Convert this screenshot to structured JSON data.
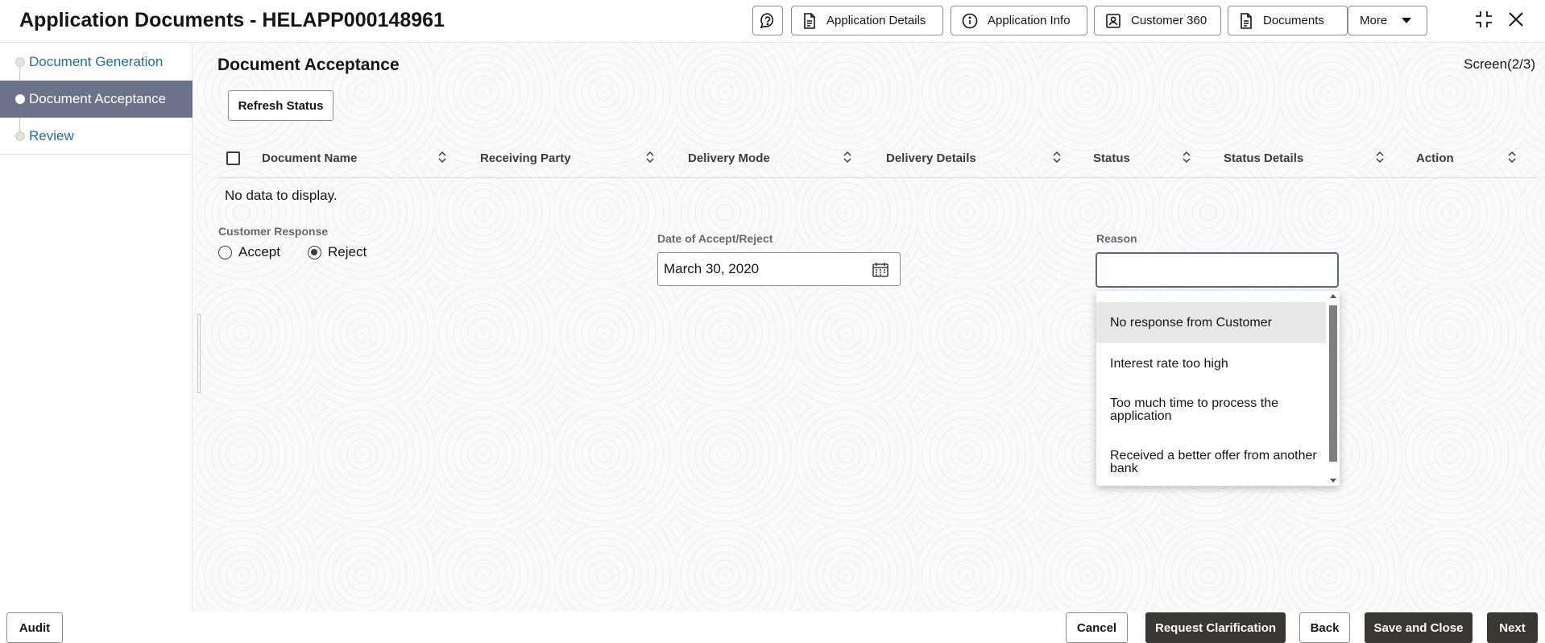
{
  "header": {
    "title": "Application Documents - HELAPP000148961",
    "buttons": [
      {
        "label": "Application Details",
        "icon": "document-icon"
      },
      {
        "label": "Application Info",
        "icon": "info-icon"
      },
      {
        "label": "Customer 360",
        "icon": "customer-card-icon"
      },
      {
        "label": "Documents",
        "icon": "document-icon"
      },
      {
        "label": "More",
        "icon": "chevron-down-icon"
      }
    ]
  },
  "sidebar": {
    "items": [
      {
        "label": "Document Generation",
        "active": false
      },
      {
        "label": "Document Acceptance",
        "active": true
      },
      {
        "label": "Review",
        "active": false
      }
    ]
  },
  "main": {
    "section_title": "Document Acceptance",
    "screen_count": "Screen(2/3)",
    "refresh_label": "Refresh Status",
    "table": {
      "columns": [
        "Document Name",
        "Receiving Party",
        "Delivery Mode",
        "Delivery Details",
        "Status",
        "Status Details",
        "Action"
      ],
      "empty_text": "No data to display."
    },
    "customer_response": {
      "label": "Customer Response",
      "options": [
        "Accept",
        "Reject"
      ],
      "selected": "Reject"
    },
    "date": {
      "label": "Date of Accept/Reject",
      "value": "March 30, 2020"
    },
    "reason": {
      "label": "Reason",
      "value": "",
      "options": [
        "No response from Customer",
        "Interest rate too high",
        "Too much time to process the application",
        "Received a better offer from another bank"
      ],
      "highlighted": "No response from Customer"
    }
  },
  "footer": {
    "audit": "Audit",
    "cancel": "Cancel",
    "request_clarification": "Request Clarification",
    "back": "Back",
    "save_close": "Save and Close",
    "next": "Next"
  },
  "colors": {
    "accent_nav": "#6b7289",
    "dark_button": "#3a3632",
    "link": "#1e6f9f"
  }
}
